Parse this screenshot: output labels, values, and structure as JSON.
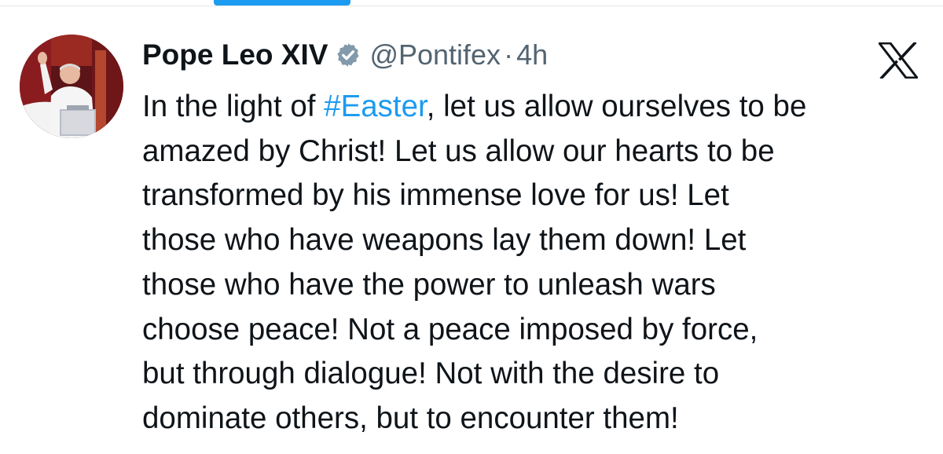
{
  "author": {
    "name": "Pope Leo XIV",
    "handle": "@Pontifex",
    "separator": "·",
    "time": "4h",
    "verified_icon": "verified-badge-icon",
    "verified_color": "#829aab"
  },
  "platform_logo": "x-logo-icon",
  "tweet": {
    "hashtag": "#Easter",
    "hashtag_color": "#1d9bf0",
    "lines": [
      {
        "before": "In the light of ",
        "after": ", let us allow ourselves to be"
      },
      "amazed by Christ!  Let us allow our hearts to be",
      "transformed by his immense love for us!  Let",
      "those who have weapons lay them down!  Let",
      "those who have the power to unleash wars",
      "choose peace!  Not a peace imposed by force,",
      "but through dialogue!  Not with the desire to",
      "dominate others, but to encounter them!"
    ]
  },
  "colors": {
    "text": "#0f1419",
    "secondary_text": "#536471",
    "accent": "#1d9bf0"
  }
}
